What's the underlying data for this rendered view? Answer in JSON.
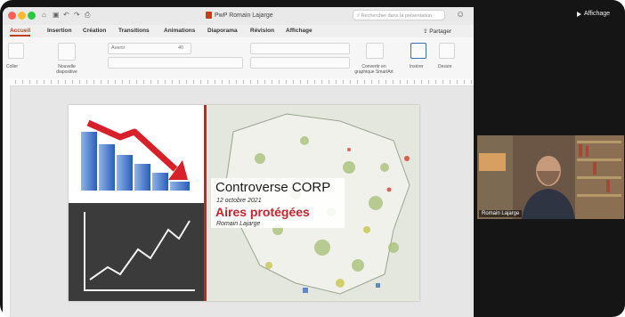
{
  "app": {
    "doc_title": "PwP Romain Lajarge",
    "search_placeholder": "Rechercher dans la présentation"
  },
  "tabs": [
    {
      "label": "Accueil",
      "active": true
    },
    {
      "label": "Insertion"
    },
    {
      "label": "Création"
    },
    {
      "label": "Transitions"
    },
    {
      "label": "Animations"
    },
    {
      "label": "Diaporama"
    },
    {
      "label": "Révision"
    },
    {
      "label": "Affichage"
    }
  ],
  "share_label": "Partager",
  "ribbon": {
    "paste_label": "Coller",
    "new_slide_label": "Nouvelle diapositive",
    "font_name": "Avenir",
    "font_size": "40",
    "convert_label": "Convertir en graphique SmartArt",
    "insert_label": "Insérer",
    "draw_label": "Dessin"
  },
  "slide": {
    "title": "Controverse CORP",
    "date": "12 octobre 2021",
    "subtitle": "Aires protégées",
    "author": "Romain Lajarge"
  },
  "right": {
    "affichage_label": "Affichage",
    "camera_name": "Romain Lajarge"
  },
  "colors": {
    "accent": "#c43e1c",
    "slide_red": "#c8232c",
    "screen_bg": "#151515"
  }
}
